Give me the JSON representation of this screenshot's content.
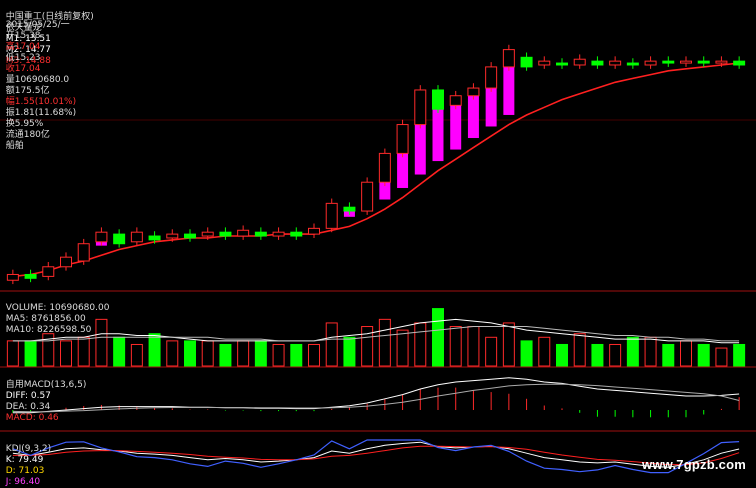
{
  "colors": {
    "background": "#000000",
    "up_candle": "#ff2a2a",
    "down_candle": "#00ff00",
    "magenta_bar": "#ff00ff",
    "red_line": "#ff2020",
    "white_line": "#ffffff",
    "blue_line": "#4060ff",
    "divider": "#a01010"
  },
  "header": {
    "stock_name": "中国重工(日线前复权)",
    "indicator": "依天量龙",
    "m1": "M1: 15.51",
    "m2": "M2: 14.77",
    "m3": "M3: 14.88",
    "date": "2015/05/25/一",
    "open": "开15.38",
    "high": "高17.04",
    "low": "低15.23",
    "close": "收17.04",
    "volume": "量10690680.0",
    "amount": "额175.5亿",
    "change": "幅1.55(10.01%)",
    "amplitude": "振1.81(11.68%)",
    "turnover": "换5.95%",
    "float_cap": "流通180亿",
    "sector": "船舶"
  },
  "volume_panel": {
    "label": "VOLUME: 10690680.00",
    "ma5": "MA5: 8761856.00",
    "ma10": "MA10: 8226598.50"
  },
  "macd_panel": {
    "label": "自用MACD(13,6,5)",
    "diff": "DIFF: 0.57",
    "dea": "DEA: 0.34",
    "macd": "MACD: 0.46"
  },
  "kdj_panel": {
    "label": "KDJ(9,3,2)",
    "k": "K: 79.49",
    "d": "D: 71.03",
    "j": "J: 96.40"
  },
  "watermark": "www.7gpzb.com",
  "chart_data": {
    "type": "candlestick",
    "title": "中国重工(日线前复权)",
    "candles": [
      {
        "o": 9.3,
        "c": 9.6
      },
      {
        "o": 9.6,
        "c": 9.4
      },
      {
        "o": 9.5,
        "c": 10.0
      },
      {
        "o": 10.0,
        "c": 10.5
      },
      {
        "o": 10.3,
        "c": 11.2
      },
      {
        "o": 11.3,
        "c": 11.8
      },
      {
        "o": 11.7,
        "c": 11.2
      },
      {
        "o": 11.3,
        "c": 11.8
      },
      {
        "o": 11.6,
        "c": 11.4
      },
      {
        "o": 11.5,
        "c": 11.7
      },
      {
        "o": 11.7,
        "c": 11.5
      },
      {
        "o": 11.6,
        "c": 11.8
      },
      {
        "o": 11.8,
        "c": 11.6
      },
      {
        "o": 11.6,
        "c": 11.9
      },
      {
        "o": 11.8,
        "c": 11.6
      },
      {
        "o": 11.6,
        "c": 11.8
      },
      {
        "o": 11.8,
        "c": 11.6
      },
      {
        "o": 11.7,
        "c": 12.0
      },
      {
        "o": 12.0,
        "c": 13.3
      },
      {
        "o": 13.1,
        "c": 12.9
      },
      {
        "o": 12.9,
        "c": 14.4
      },
      {
        "o": 14.4,
        "c": 15.9
      },
      {
        "o": 15.9,
        "c": 17.4
      },
      {
        "o": 17.4,
        "c": 19.2
      },
      {
        "o": 19.2,
        "c": 18.2
      },
      {
        "o": 18.4,
        "c": 18.9
      },
      {
        "o": 18.9,
        "c": 19.3
      },
      {
        "o": 19.3,
        "c": 20.4
      },
      {
        "o": 20.4,
        "c": 21.3
      },
      {
        "o": 20.9,
        "c": 20.4
      },
      {
        "o": 20.5,
        "c": 20.7
      },
      {
        "o": 20.6,
        "c": 20.5
      },
      {
        "o": 20.5,
        "c": 20.8
      },
      {
        "o": 20.7,
        "c": 20.5
      },
      {
        "o": 20.5,
        "c": 20.7
      },
      {
        "o": 20.6,
        "c": 20.5
      },
      {
        "o": 20.5,
        "c": 20.7
      },
      {
        "o": 20.7,
        "c": 20.6
      },
      {
        "o": 20.6,
        "c": 20.7
      },
      {
        "o": 20.7,
        "c": 20.6
      },
      {
        "o": 20.6,
        "c": 20.7
      },
      {
        "o": 20.7,
        "c": 20.5
      }
    ],
    "volume": [
      7,
      7,
      9,
      7,
      8,
      13,
      8,
      6,
      9,
      7,
      7,
      7,
      6,
      7,
      7,
      6,
      6,
      6,
      12,
      8,
      11,
      13,
      10,
      12,
      16,
      11,
      11,
      8,
      12,
      7,
      8,
      6,
      9,
      6,
      6,
      8,
      8,
      6,
      7,
      6,
      5,
      6
    ],
    "ma_red": [
      9.5,
      9.6,
      9.8,
      10.1,
      10.3,
      10.6,
      10.9,
      11.1,
      11.3,
      11.4,
      11.5,
      11.5,
      11.6,
      11.6,
      11.6,
      11.7,
      11.7,
      11.7,
      11.9,
      12.1,
      12.5,
      13.0,
      13.6,
      14.3,
      15.0,
      15.6,
      16.2,
      16.8,
      17.4,
      17.9,
      18.3,
      18.7,
      19.0,
      19.3,
      19.6,
      19.8,
      20.0,
      20.2,
      20.3,
      20.4,
      20.5,
      20.6
    ],
    "volume_ma5": [
      7,
      7,
      7.5,
      8,
      8,
      9,
      9,
      8.5,
      8.5,
      8,
      7.5,
      7,
      7,
      7,
      7,
      7,
      7,
      7,
      8,
      8.5,
      9,
      10,
      11,
      12,
      12.5,
      13,
      12.5,
      12,
      11,
      10,
      9.5,
      9,
      8.5,
      8,
      7.5,
      7.5,
      7.5,
      7,
      7,
      7,
      6.5,
      6.5
    ],
    "volume_ma10": [
      7,
      7,
      7,
      7.5,
      7.5,
      8,
      8,
      8,
      8,
      8,
      8,
      8,
      7.5,
      7.5,
      7.5,
      7,
      7,
      7,
      7.5,
      7.5,
      8,
      8.5,
      9,
      9.5,
      10,
      10.5,
      11,
      11,
      11,
      11,
      10.5,
      10,
      9.5,
      9,
      8.5,
      8.5,
      8,
      8,
      7.5,
      7.5,
      7,
      7
    ],
    "macd_diff": [
      -0.1,
      -0.1,
      -0.05,
      0,
      0.05,
      0.1,
      0.12,
      0.12,
      0.12,
      0.12,
      0.1,
      0.1,
      0.08,
      0.08,
      0.06,
      0.06,
      0.05,
      0.05,
      0.1,
      0.15,
      0.25,
      0.4,
      0.55,
      0.75,
      0.9,
      1.0,
      1.05,
      1.1,
      1.15,
      1.1,
      1.0,
      0.95,
      0.85,
      0.75,
      0.7,
      0.65,
      0.6,
      0.55,
      0.5,
      0.5,
      0.52,
      0.57
    ],
    "macd_dea": [
      -0.05,
      -0.06,
      -0.06,
      -0.04,
      -0.02,
      0.01,
      0.04,
      0.06,
      0.08,
      0.09,
      0.09,
      0.09,
      0.09,
      0.09,
      0.08,
      0.08,
      0.07,
      0.07,
      0.08,
      0.1,
      0.14,
      0.2,
      0.28,
      0.38,
      0.5,
      0.6,
      0.7,
      0.78,
      0.86,
      0.9,
      0.92,
      0.92,
      0.9,
      0.87,
      0.82,
      0.78,
      0.73,
      0.68,
      0.63,
      0.58,
      0.5,
      0.34
    ],
    "macd_hist": [
      -0.1,
      -0.08,
      0,
      0.08,
      0.14,
      0.18,
      0.16,
      0.12,
      0.08,
      0.06,
      0.02,
      0.02,
      -0.02,
      -0.02,
      -0.04,
      -0.04,
      -0.04,
      -0.04,
      0.04,
      0.1,
      0.22,
      0.4,
      0.54,
      0.74,
      0.8,
      0.8,
      0.7,
      0.64,
      0.58,
      0.4,
      0.16,
      0.06,
      -0.1,
      -0.24,
      -0.24,
      -0.26,
      -0.26,
      -0.26,
      -0.26,
      -0.16,
      0.04,
      0.46
    ],
    "kdj_k": [
      70,
      65,
      72,
      80,
      82,
      78,
      75,
      70,
      68,
      65,
      60,
      55,
      58,
      55,
      50,
      52,
      55,
      60,
      75,
      70,
      80,
      88,
      92,
      95,
      85,
      82,
      84,
      86,
      80,
      70,
      60,
      55,
      50,
      48,
      50,
      45,
      40,
      38,
      45,
      55,
      70,
      79.49
    ],
    "kdj_d": [
      65,
      65,
      67,
      72,
      75,
      76,
      76,
      74,
      72,
      70,
      67,
      63,
      61,
      59,
      56,
      55,
      55,
      57,
      63,
      65,
      70,
      76,
      82,
      86,
      86,
      85,
      84,
      85,
      83,
      79,
      72,
      66,
      61,
      56,
      54,
      51,
      47,
      44,
      44,
      48,
      58,
      71.03
    ],
    "kdj_j": [
      80,
      65,
      82,
      95,
      96,
      82,
      73,
      62,
      60,
      55,
      46,
      40,
      52,
      47,
      38,
      46,
      55,
      66,
      98,
      80,
      100,
      100,
      100,
      100,
      83,
      76,
      84,
      88,
      74,
      52,
      36,
      33,
      28,
      32,
      42,
      33,
      26,
      26,
      47,
      69,
      94,
      96.4
    ]
  }
}
